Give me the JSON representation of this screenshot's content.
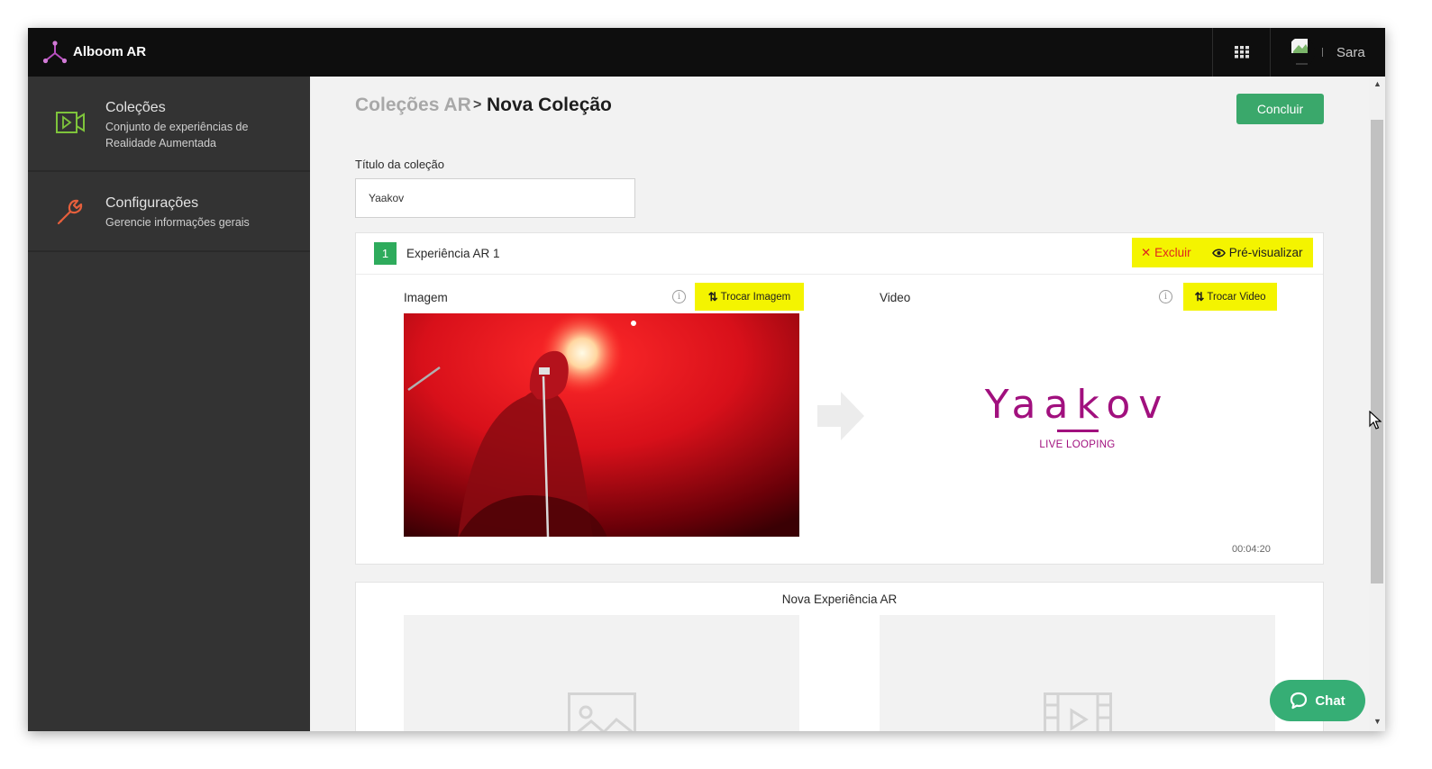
{
  "app": {
    "title": "Alboom AR",
    "brand_color": "#0e0e0e",
    "accent_green": "#3aa86b",
    "highlight_color": "#f4f400"
  },
  "topbar": {
    "apps_icon": "grid-icon",
    "user_name": "Sara"
  },
  "sidebar": {
    "items": [
      {
        "title": "Coleções",
        "description": "Conjunto de experiências de Realidade Aumentada",
        "icon": "video-ar-icon"
      },
      {
        "title": "Configurações",
        "description": "Gerencie informações gerais",
        "icon": "wrench-icon"
      }
    ]
  },
  "breadcrumb": {
    "root": "Coleções AR",
    "separator": ">",
    "current": "Nova Coleção"
  },
  "actions": {
    "done_label": "Concluir"
  },
  "form": {
    "title_label": "Título da coleção",
    "title_value": "Yaakov"
  },
  "experience": {
    "number": "1",
    "title": "Experiência AR 1",
    "delete_label": "Excluir",
    "preview_label": "Pré-visualizar",
    "image_label": "Imagem",
    "swap_image_label": "Trocar Imagem",
    "video_label": "Video",
    "swap_video_label": "Trocar Video",
    "video_brand": "Yaakov",
    "video_subtitle": "LIVE LOOPING",
    "duration": "00:04:20"
  },
  "new_experience": {
    "title": "Nova Experiência AR"
  },
  "chat": {
    "label": "Chat"
  }
}
